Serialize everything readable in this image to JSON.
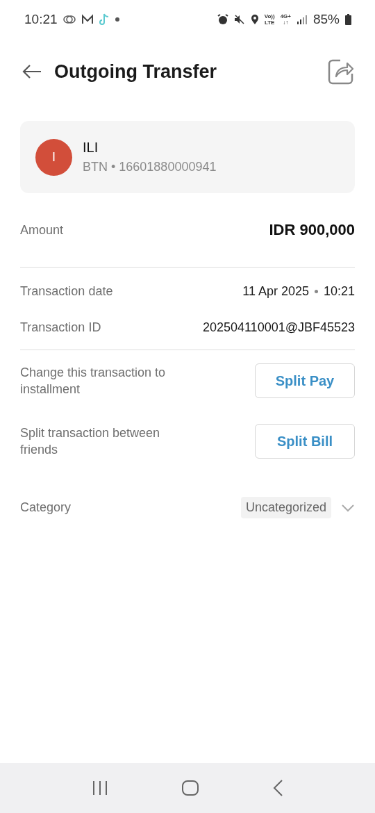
{
  "status_bar": {
    "time": "10:21",
    "network_labels": [
      {
        "top": "Vo))",
        "bottom": "LTE"
      },
      {
        "top": "4G+",
        "bottom": "↓↑"
      }
    ],
    "battery": "85%"
  },
  "header": {
    "title": "Outgoing Transfer"
  },
  "recipient": {
    "initial": "I",
    "color": "#d24e3a",
    "name": "ILI",
    "account": "BTN • 16601880000941"
  },
  "amount": {
    "label": "Amount",
    "value": "IDR 900,000"
  },
  "details": [
    {
      "label": "Transaction date",
      "value": "11 Apr 2025",
      "time": "10:21"
    },
    {
      "label": "Transaction ID",
      "value": "202504110001@JBF45523"
    }
  ],
  "actions": [
    {
      "text": "Change this transaction to installment",
      "button": "Split Pay"
    },
    {
      "text": "Split transaction between friends",
      "button": "Split Bill"
    }
  ],
  "category": {
    "label": "Category",
    "value": "Uncategorized"
  }
}
